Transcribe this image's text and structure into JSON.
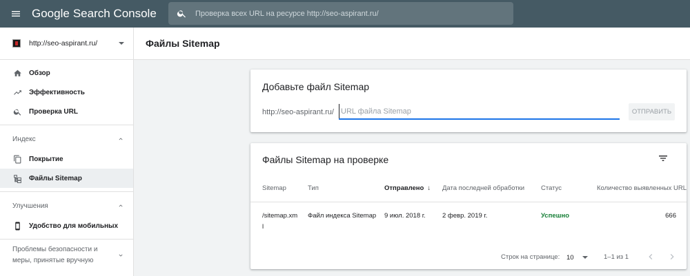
{
  "app": {
    "logo_google": "Google",
    "logo_product": "Search Console",
    "search_placeholder": "Проверка всех URL на ресурсе http://seo-aspirant.ru/"
  },
  "sidebar": {
    "property": "http://seo-aspirant.ru/",
    "main_items": [
      {
        "label": "Обзор",
        "icon": "home-icon"
      },
      {
        "label": "Эффективность",
        "icon": "trending-up-icon"
      },
      {
        "label": "Проверка URL",
        "icon": "search-icon"
      }
    ],
    "index_section": {
      "label": "Индекс",
      "items": [
        {
          "label": "Покрытие",
          "icon": "copy-icon"
        },
        {
          "label": "Файлы Sitemap",
          "icon": "sitemap-icon",
          "active": true
        }
      ]
    },
    "enhancements_section": {
      "label": "Улучшения",
      "items": [
        {
          "label": "Удобство для мобильных",
          "icon": "smartphone-icon"
        }
      ]
    },
    "security_section": {
      "label": "Проблемы безопасности и меры, принятые вручную"
    }
  },
  "page": {
    "title": "Файлы Sitemap"
  },
  "add_sitemap": {
    "title": "Добавьте файл Sitemap",
    "prefix": "http://seo-aspirant.ru/",
    "placeholder": "URL файла Sitemap",
    "submit_label": "ОТПРАВИТЬ"
  },
  "sitemap_list": {
    "title": "Файлы Sitemap на проверке",
    "columns": [
      "Sitemap",
      "Тип",
      "Отправлено",
      "Дата последней обработки",
      "Статус",
      "Количество выявленных URL"
    ],
    "sort_arrow": "↓",
    "rows": [
      {
        "sitemap": "/sitemap.xml",
        "type": "Файл индекса Sitemap",
        "submitted": "9 июл. 2018 г.",
        "last_read": "2 февр. 2019 г.",
        "status": "Успешно",
        "discovered_urls": "666"
      }
    ],
    "pagination": {
      "rows_per_page_label": "Строк на странице:",
      "rows_per_page": "10",
      "range": "1–1 из 1"
    }
  },
  "colors": {
    "topbar": "#455a64",
    "accent": "#1a73e8",
    "success": "#188038"
  }
}
